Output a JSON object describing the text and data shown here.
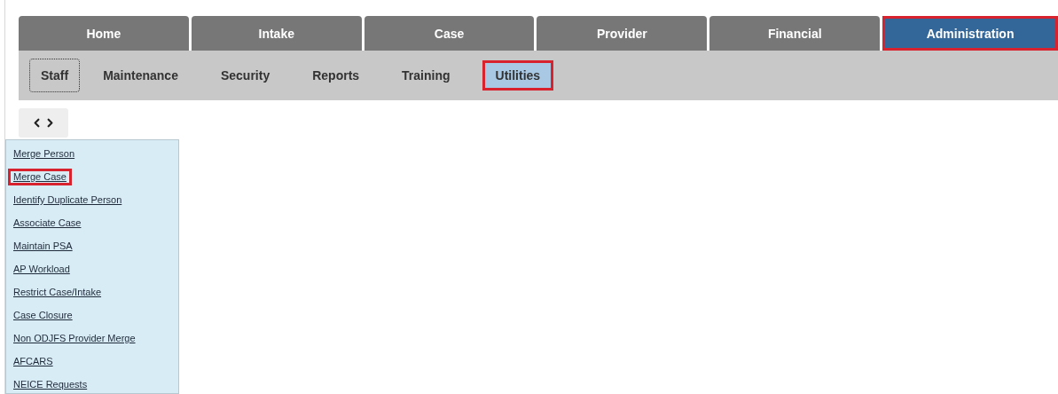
{
  "main_tabs": [
    {
      "label": "Home",
      "selected": false,
      "highlighted": false
    },
    {
      "label": "Intake",
      "selected": false,
      "highlighted": false
    },
    {
      "label": "Case",
      "selected": false,
      "highlighted": false
    },
    {
      "label": "Provider",
      "selected": false,
      "highlighted": false
    },
    {
      "label": "Financial",
      "selected": false,
      "highlighted": false
    },
    {
      "label": "Administration",
      "selected": true,
      "highlighted": true
    }
  ],
  "sub_tabs": [
    {
      "label": "Staff",
      "selected": false,
      "focused": true,
      "highlighted": false
    },
    {
      "label": "Maintenance",
      "selected": false,
      "focused": false,
      "highlighted": false
    },
    {
      "label": "Security",
      "selected": false,
      "focused": false,
      "highlighted": false
    },
    {
      "label": "Reports",
      "selected": false,
      "focused": false,
      "highlighted": false
    },
    {
      "label": "Training",
      "selected": false,
      "focused": false,
      "highlighted": false
    },
    {
      "label": "Utilities",
      "selected": true,
      "focused": false,
      "highlighted": true
    }
  ],
  "sidebar": {
    "items": [
      {
        "label": "Merge Person",
        "highlighted": false
      },
      {
        "label": "Merge Case",
        "highlighted": true
      },
      {
        "label": "Identify Duplicate Person",
        "highlighted": false
      },
      {
        "label": "Associate Case",
        "highlighted": false
      },
      {
        "label": "Maintain PSA",
        "highlighted": false
      },
      {
        "label": "AP Workload",
        "highlighted": false
      },
      {
        "label": "Restrict Case/Intake",
        "highlighted": false
      },
      {
        "label": "Case Closure",
        "highlighted": false
      },
      {
        "label": "Non ODJFS Provider Merge",
        "highlighted": false
      },
      {
        "label": "AFCARS",
        "highlighted": false
      },
      {
        "label": "NEICE Requests",
        "highlighted": false
      }
    ]
  }
}
